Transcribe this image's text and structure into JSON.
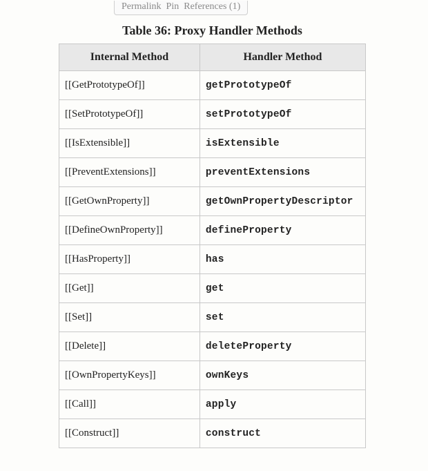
{
  "popup": {
    "items": [
      "Permalink",
      "Pin",
      "References (1)"
    ]
  },
  "caption": "Table 36: Proxy Handler Methods",
  "headers": {
    "col1": "Internal Method",
    "col2": "Handler Method"
  },
  "rows": [
    {
      "internal": "[[GetPrototypeOf]]",
      "handler": "getPrototypeOf"
    },
    {
      "internal": "[[SetPrototypeOf]]",
      "handler": "setPrototypeOf"
    },
    {
      "internal": "[[IsExtensible]]",
      "handler": "isExtensible"
    },
    {
      "internal": "[[PreventExtensions]]",
      "handler": "preventExtensions"
    },
    {
      "internal": "[[GetOwnProperty]]",
      "handler": "getOwnPropertyDescriptor"
    },
    {
      "internal": "[[DefineOwnProperty]]",
      "handler": "defineProperty"
    },
    {
      "internal": "[[HasProperty]]",
      "handler": "has"
    },
    {
      "internal": "[[Get]]",
      "handler": "get"
    },
    {
      "internal": "[[Set]]",
      "handler": "set"
    },
    {
      "internal": "[[Delete]]",
      "handler": "deleteProperty"
    },
    {
      "internal": "[[OwnPropertyKeys]]",
      "handler": "ownKeys"
    },
    {
      "internal": "[[Call]]",
      "handler": "apply"
    },
    {
      "internal": "[[Construct]]",
      "handler": "construct"
    }
  ]
}
